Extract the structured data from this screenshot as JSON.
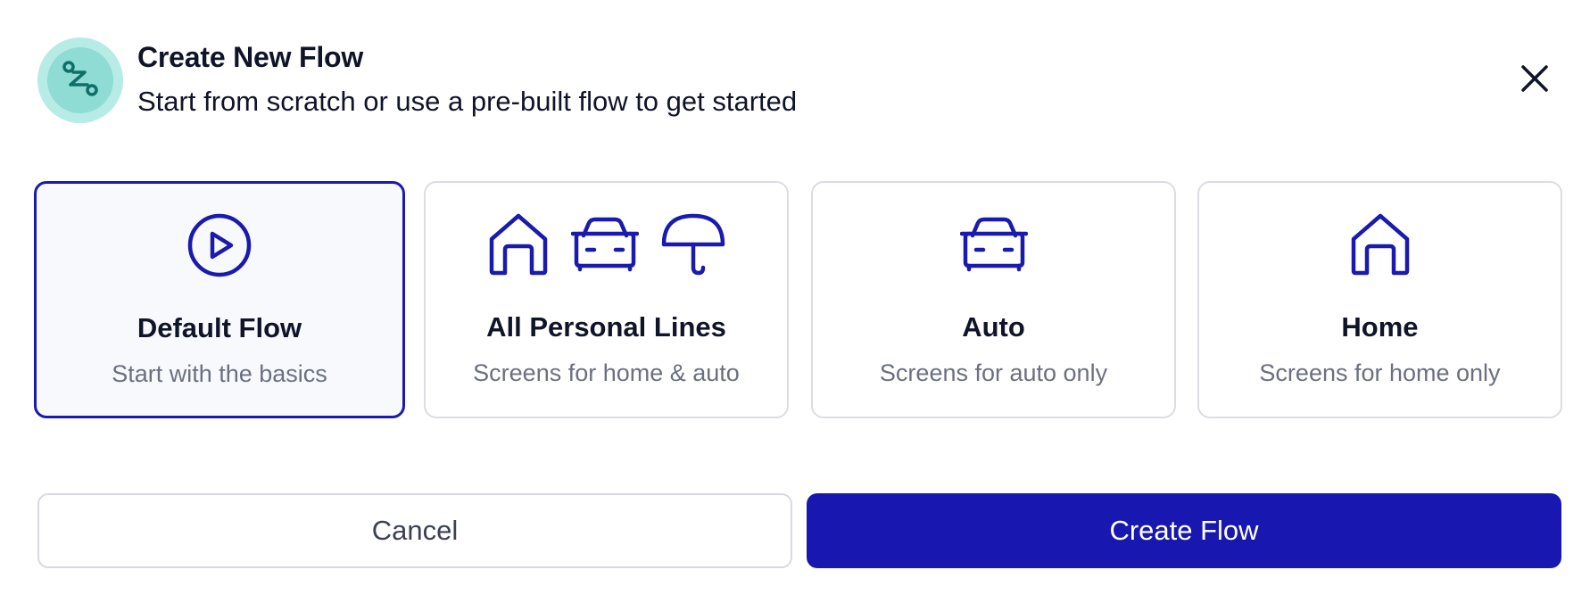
{
  "header": {
    "title": "Create New Flow",
    "subtitle": "Start from scratch or use a pre-built flow to get started",
    "badge_icon": "route-icon",
    "close_icon": "close-icon"
  },
  "cards": [
    {
      "title": "Default Flow",
      "description": "Start with the basics",
      "icons": [
        "play-circle-icon"
      ],
      "selected": true
    },
    {
      "title": "All Personal Lines",
      "description": "Screens for home & auto",
      "icons": [
        "home-icon",
        "car-icon",
        "umbrella-icon"
      ],
      "selected": false
    },
    {
      "title": "Auto",
      "description": "Screens for auto only",
      "icons": [
        "car-icon"
      ],
      "selected": false
    },
    {
      "title": "Home",
      "description": "Screens for home only",
      "icons": [
        "home-icon"
      ],
      "selected": false
    }
  ],
  "footer": {
    "cancel_label": "Cancel",
    "create_label": "Create Flow"
  },
  "colors": {
    "accent": "#1818b0",
    "badge_bg": "#b7ebe6",
    "badge_icon": "#0f6e67"
  }
}
